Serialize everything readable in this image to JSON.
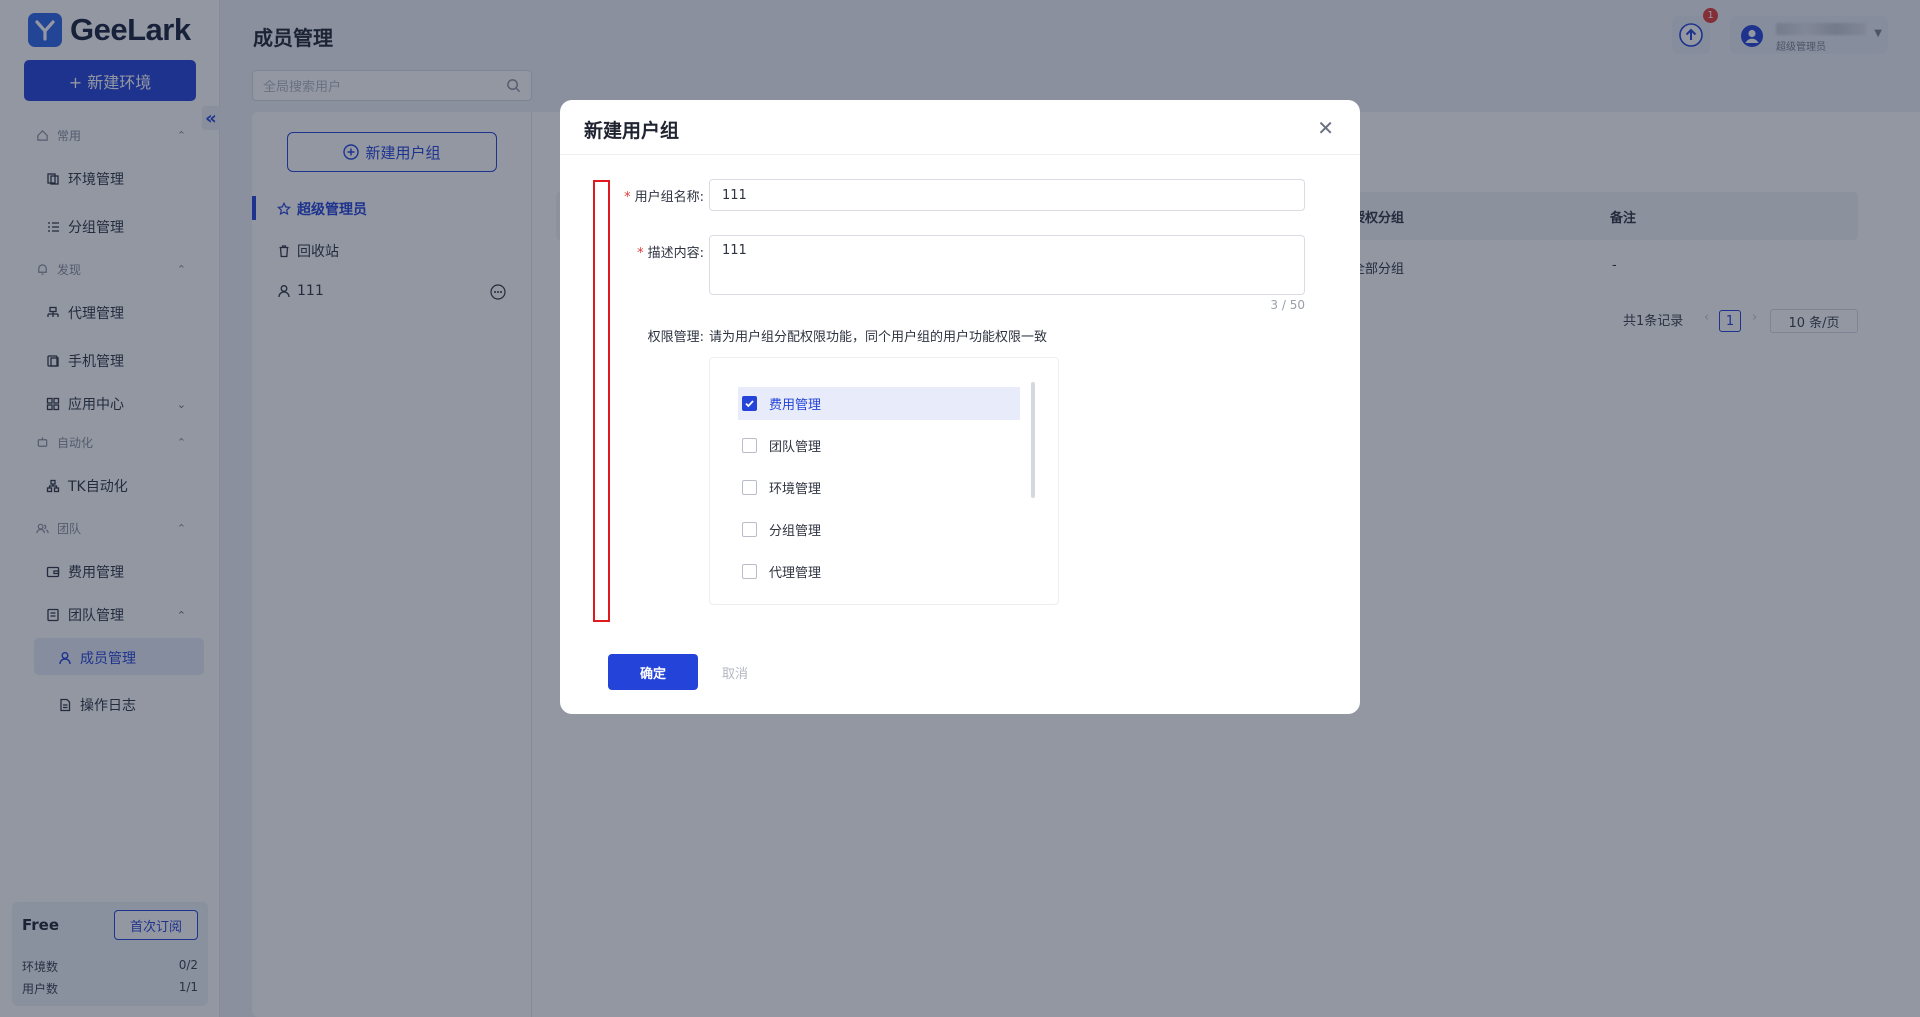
{
  "app": {
    "logo_text": "GeeLark",
    "new_env_label": "+ 新建环境",
    "collapse_glyph": "«"
  },
  "sidebar": {
    "sections": [
      {
        "label": "常用",
        "icon": "home-icon"
      },
      {
        "label": "发现",
        "icon": "bell-icon"
      },
      {
        "label": "自动化",
        "icon": "robot-icon"
      },
      {
        "label": "团队",
        "icon": "team-icon"
      }
    ],
    "items": [
      {
        "label": "环境管理",
        "icon": "environment-icon"
      },
      {
        "label": "分组管理",
        "icon": "list-icon"
      },
      {
        "label": "代理管理",
        "icon": "proxy-icon"
      },
      {
        "label": "手机管理",
        "icon": "phone-icon"
      },
      {
        "label": "应用中心",
        "icon": "grid-icon"
      },
      {
        "label": "TK自动化",
        "icon": "flow-icon"
      },
      {
        "label": "费用管理",
        "icon": "wallet-icon"
      },
      {
        "label": "团队管理",
        "icon": "team-manage-icon"
      },
      {
        "label": "成员管理",
        "icon": "user-icon"
      },
      {
        "label": "操作日志",
        "icon": "log-icon"
      }
    ],
    "plan": {
      "name": "Free",
      "subscribe_label": "首次订阅",
      "env_label": "环境数",
      "env_value": "0/2",
      "user_label": "用户数",
      "user_value": "1/1"
    }
  },
  "header": {
    "page_title": "成员管理",
    "search_placeholder": "全局搜索用户",
    "upload_badge": "1",
    "user_role": "超级管理员"
  },
  "groups": {
    "new_group_label": "新建用户组",
    "items": [
      {
        "label": "超级管理员",
        "icon": "star-icon"
      },
      {
        "label": "回收站",
        "icon": "trash-icon"
      },
      {
        "label": "111",
        "icon": "user-icon"
      }
    ]
  },
  "table": {
    "headers": [
      "授权分组",
      "备注"
    ],
    "row": [
      "全部分组",
      "-"
    ],
    "pagination": {
      "total": "共1条记录",
      "page": "1",
      "size": "10 条/页"
    }
  },
  "modal": {
    "title": "新建用户组",
    "name_label": "用户组名称:",
    "name_value": "111",
    "desc_label": "描述内容:",
    "desc_value": "111",
    "counter": "3 / 50",
    "perm_label": "权限管理:",
    "perm_hint": "请为用户组分配权限功能，同个用户组的用户功能权限一致",
    "permissions": [
      {
        "label": "费用管理",
        "checked": true
      },
      {
        "label": "团队管理",
        "checked": false
      },
      {
        "label": "环境管理",
        "checked": false
      },
      {
        "label": "分组管理",
        "checked": false
      },
      {
        "label": "代理管理",
        "checked": false
      }
    ],
    "confirm_label": "确定",
    "cancel_label": "取消"
  },
  "colors": {
    "primary": "#2443d8",
    "danger": "#e0191e",
    "overlay": "rgba(24,34,58,0.47)"
  }
}
